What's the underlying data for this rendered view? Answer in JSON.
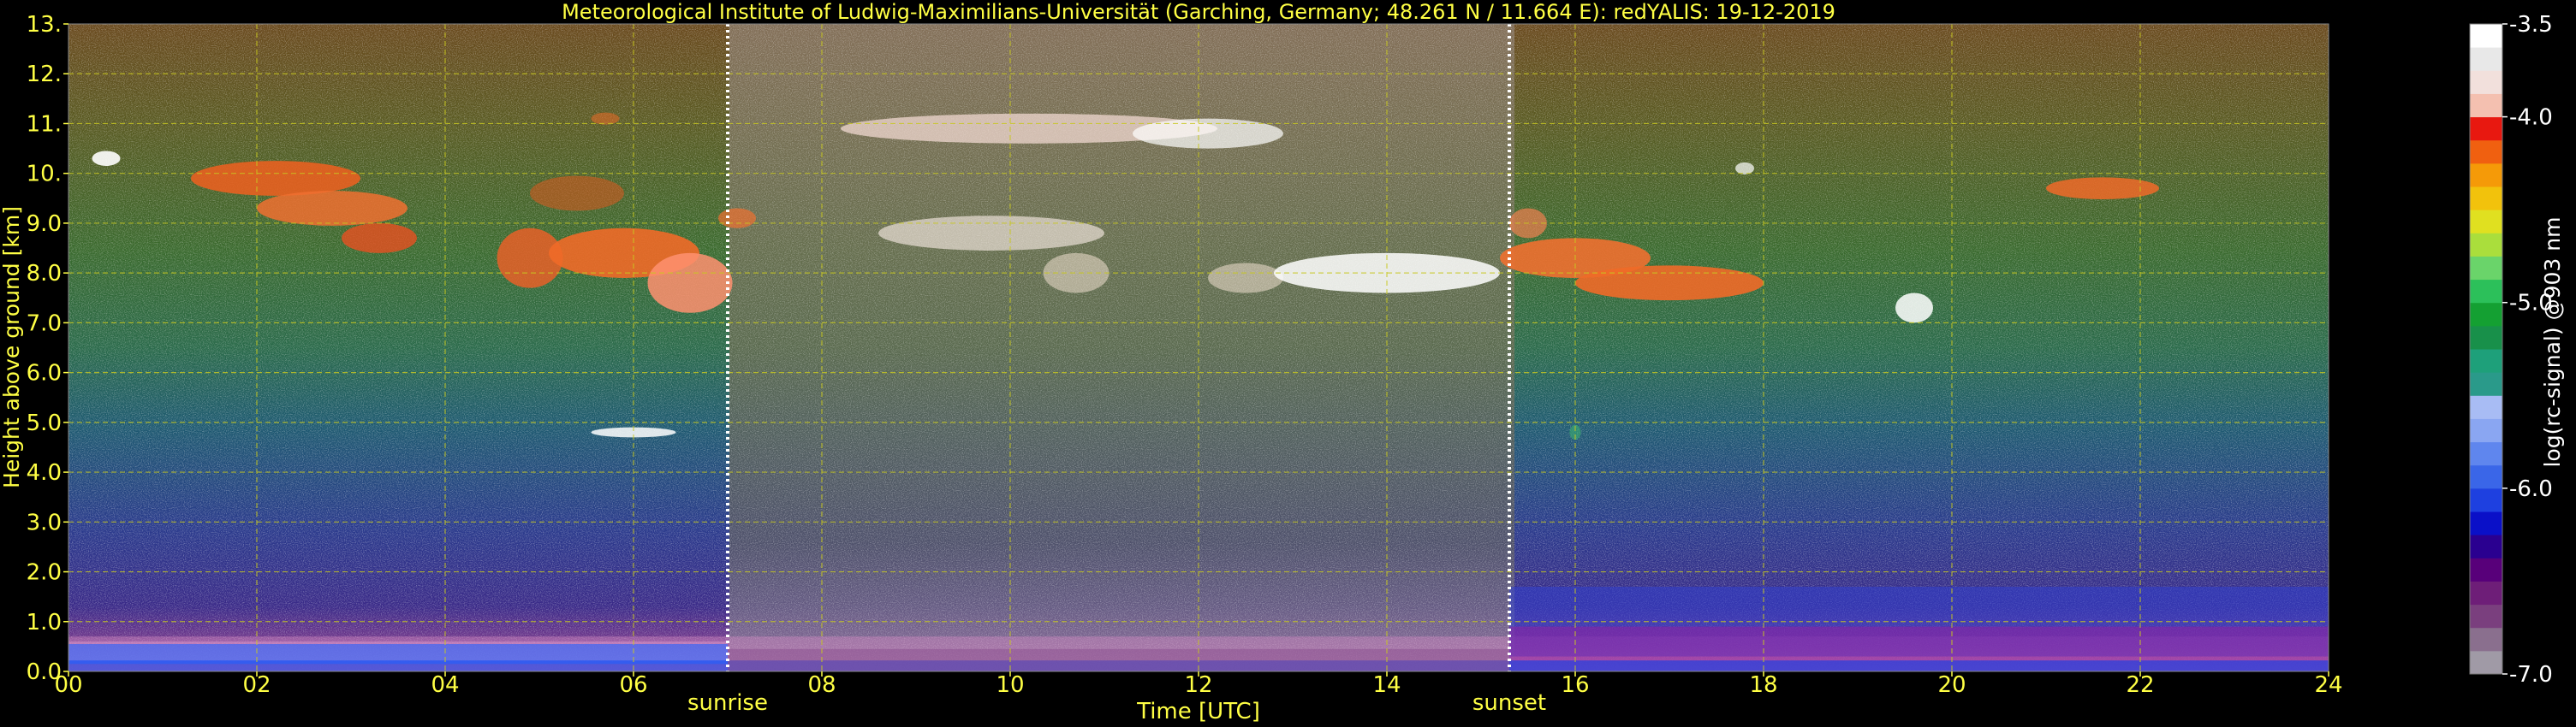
{
  "title": "Meteorological Institute of Ludwig-Maximilians-Universität (Garching, Germany; 48.261 N / 11.664 E):    redYALIS: 19-12-2019",
  "chart_data": {
    "type": "heatmap",
    "xlabel": "Time [UTC]",
    "ylabel": "Height above ground [km]",
    "x_ticks": [
      "00",
      "02",
      "04",
      "06",
      "08",
      "10",
      "12",
      "14",
      "16",
      "18",
      "20",
      "22",
      "24"
    ],
    "y_ticks": [
      "0.0",
      "1.0",
      "2.0",
      "3.0",
      "4.0",
      "5.0",
      "6.0",
      "7.0",
      "8.0",
      "9.0",
      "10.",
      "11.",
      "12.",
      "13."
    ],
    "xlim": [
      0,
      24
    ],
    "ylim": [
      0,
      13
    ],
    "grid": true,
    "markers": [
      {
        "label": "sunrise",
        "hour": 7.0
      },
      {
        "label": "sunset",
        "hour": 15.3
      }
    ],
    "colorbar": {
      "label": "log(rc-signal) @903 nm",
      "ticks": [
        "-3.5",
        "-4.0",
        "-5.0",
        "-6.0",
        "-7.0"
      ],
      "tick_values": [
        -3.5,
        -4.0,
        -5.0,
        -6.0,
        -7.0
      ],
      "range": [
        -7.0,
        -3.5
      ],
      "colors": [
        "#a09aa6",
        "#8a6f8e",
        "#7a3f7e",
        "#6e1e78",
        "#58007a",
        "#2a0090",
        "#0a10c8",
        "#1e40e0",
        "#3a66e8",
        "#5f86ee",
        "#8aa6f2",
        "#a8bcf4",
        "#2a9a8a",
        "#1ea07a",
        "#18904a",
        "#14a032",
        "#2cc05a",
        "#6ad46a",
        "#aade3c",
        "#e0e020",
        "#f2c20c",
        "#f59a08",
        "#f06010",
        "#e81810",
        "#f4c0b0",
        "#f2e0dc",
        "#e8e8e8",
        "#ffffff"
      ]
    }
  }
}
